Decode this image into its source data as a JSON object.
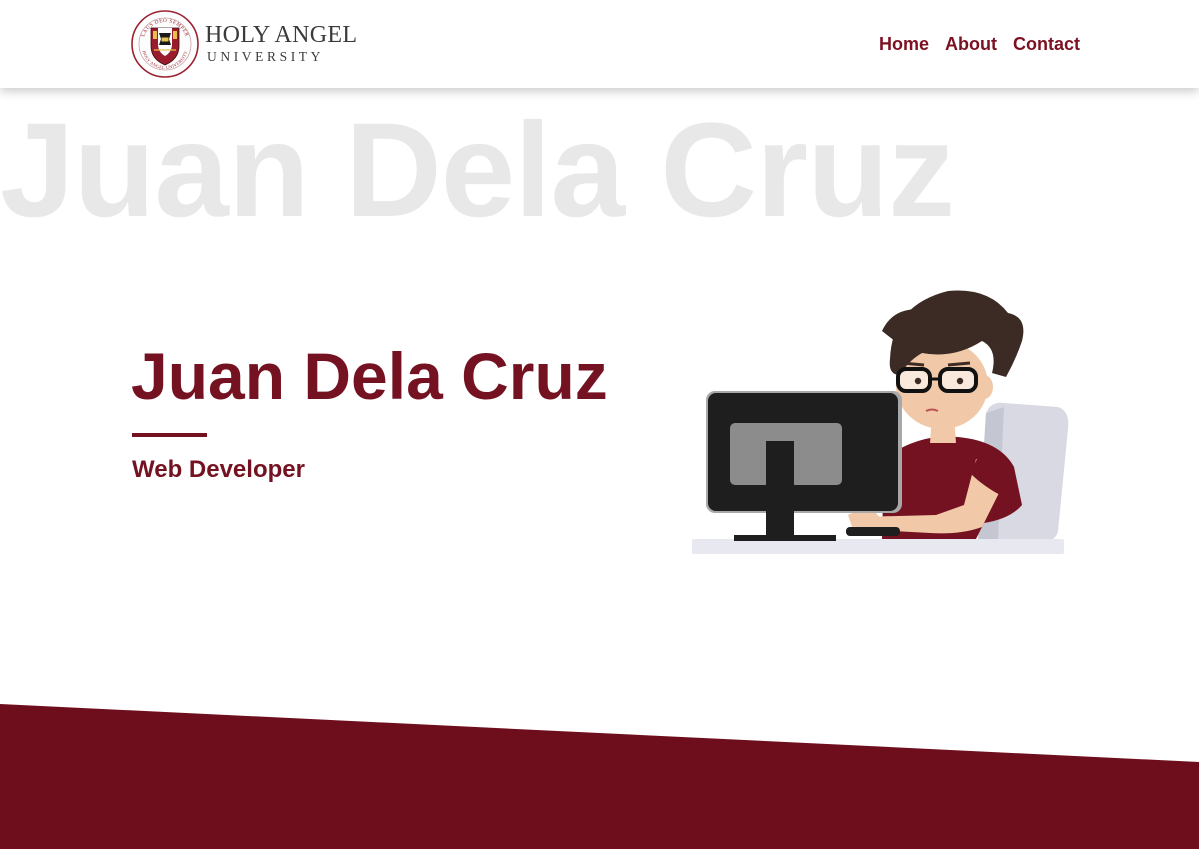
{
  "header": {
    "logo": {
      "line1": "HOLY ANGEL",
      "line2": "UNIVERSITY",
      "seal_text_top": "LAUS DEO SEMPER",
      "seal_text_bottom": "HOLY ANGEL UNIVERSITY"
    },
    "nav": [
      {
        "label": "Home"
      },
      {
        "label": "About"
      },
      {
        "label": "Contact"
      }
    ]
  },
  "hero": {
    "background_name": "Juan Dela Cruz",
    "name": "Juan Dela Cruz",
    "role": "Web Developer",
    "illustration_icon": "developer-at-computer-illustration"
  },
  "colors": {
    "brand": "#741221",
    "nav_text": "#7b1121",
    "background_text": "#e8e8e8",
    "footer": "#6e0e1c"
  }
}
